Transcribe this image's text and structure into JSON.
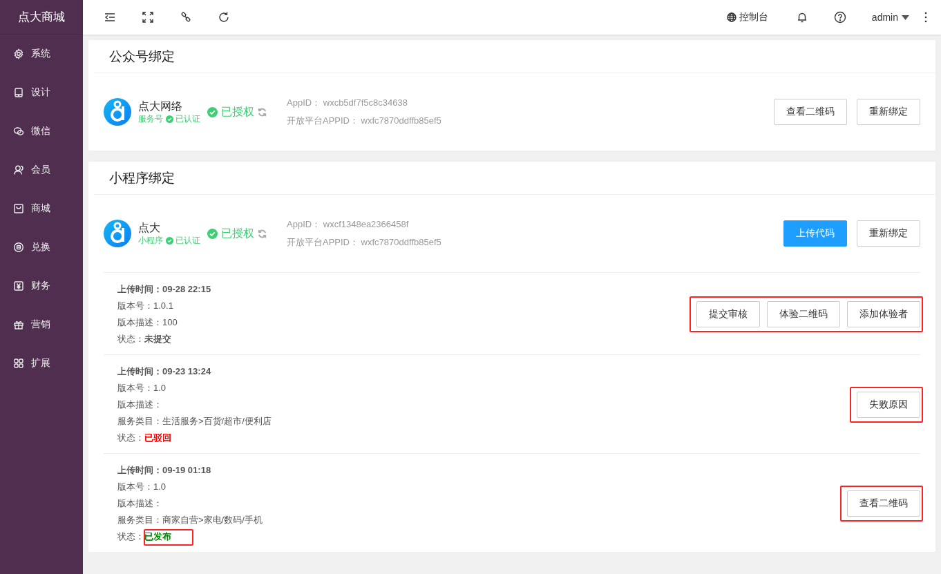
{
  "brand": "点大商城",
  "sidebar": {
    "items": [
      {
        "label": "系统"
      },
      {
        "label": "设计"
      },
      {
        "label": "微信"
      },
      {
        "label": "会员"
      },
      {
        "label": "商城"
      },
      {
        "label": "兑换"
      },
      {
        "label": "财务"
      },
      {
        "label": "营销"
      },
      {
        "label": "扩展"
      }
    ]
  },
  "topbar": {
    "console": "控制台",
    "user": "admin"
  },
  "official": {
    "title": "公众号绑定",
    "name": "点大网络",
    "type": "服务号",
    "verified": "已认证",
    "auth": "已授权",
    "appid_label": "AppID：",
    "appid": "wxcb5df7f5c8c34638",
    "open_label": "开放平台APPID：",
    "open_appid": "wxfc7870ddffb85ef5",
    "buttons": [
      {
        "label": "查看二维码",
        "primary": false
      },
      {
        "label": "重新绑定",
        "primary": false
      }
    ]
  },
  "mini": {
    "title": "小程序绑定",
    "name": "点大",
    "type": "小程序",
    "verified": "已认证",
    "auth": "已授权",
    "appid_label": "AppID：",
    "appid": "wxcf1348ea2366458f",
    "open_label": "开放平台APPID：",
    "open_appid": "wxfc7870ddffb85ef5",
    "buttons": [
      {
        "label": "上传代码",
        "primary": true
      },
      {
        "label": "重新绑定",
        "primary": false
      }
    ],
    "versions": [
      {
        "time": "上传时间：09-28 22:15",
        "fields": [
          "版本号：1.0.1",
          "版本描述：100"
        ],
        "status_label": "状态：",
        "status": "未提交",
        "color": "#555555",
        "status_highlighted": false,
        "actions": [
          "提交审核",
          "体验二维码",
          "添加体验者"
        ],
        "actions_highlighted": true
      },
      {
        "time": "上传时间：09-23 13:24",
        "fields": [
          "版本号：1.0",
          "版本描述：",
          "服务类目：生活服务>百货/超市/便利店"
        ],
        "status_label": "状态：",
        "status": "已驳回",
        "color": "#ff0000",
        "status_highlighted": false,
        "actions": [
          "失败原因"
        ],
        "actions_highlighted": true
      },
      {
        "time": "上传时间：09-19 01:18",
        "fields": [
          "版本号：1.0",
          "版本描述：",
          "服务类目：商家自营>家电/数码/手机"
        ],
        "status_label": "状态：",
        "status": "已发布",
        "color": "#008800",
        "status_highlighted": true,
        "actions": [
          "查看二维码"
        ],
        "actions_highlighted": true
      }
    ]
  }
}
